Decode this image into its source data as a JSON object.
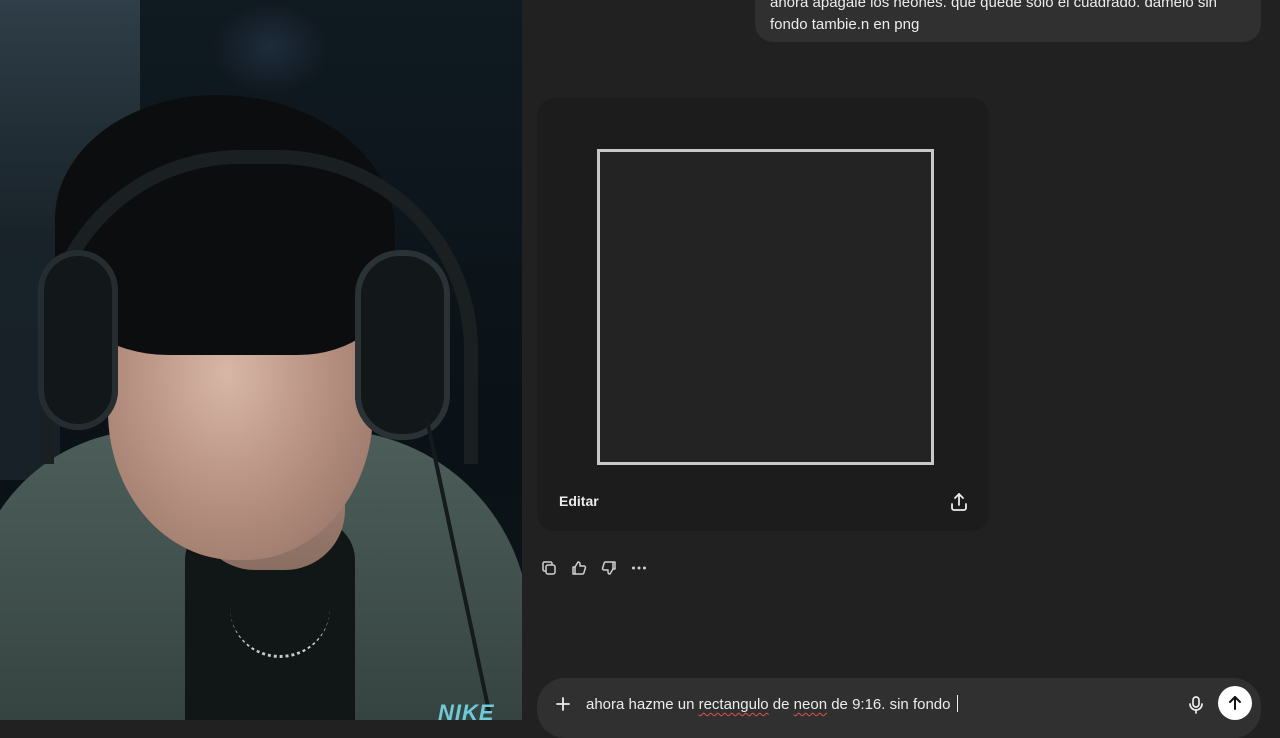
{
  "chat": {
    "user_message": "ahora apagale los neones. que quede solo el cuadrado. damelo sin fondo tambie.n en png",
    "image_card": {
      "edit_label": "Editar",
      "share_icon": "share-upload-icon"
    },
    "actions": {
      "copy_icon": "copy-icon",
      "like_icon": "thumbs-up-icon",
      "dislike_icon": "thumbs-down-icon",
      "more_icon": "more-dots-icon"
    },
    "composer": {
      "plus_icon": "plus-icon",
      "input_parts": [
        "ahora hazme un ",
        "rectangulo",
        " de ",
        "neon",
        " de 9:16. sin fondo "
      ],
      "mic_icon": "microphone-icon",
      "send_icon": "arrow-up-icon"
    }
  },
  "webcam": {
    "brand_text": "NIKE"
  },
  "colors": {
    "background": "#212121",
    "bubble": "#303030",
    "image_card": "#1c1c1c",
    "frame_border": "#c8c8c8",
    "text": "#ececec"
  }
}
